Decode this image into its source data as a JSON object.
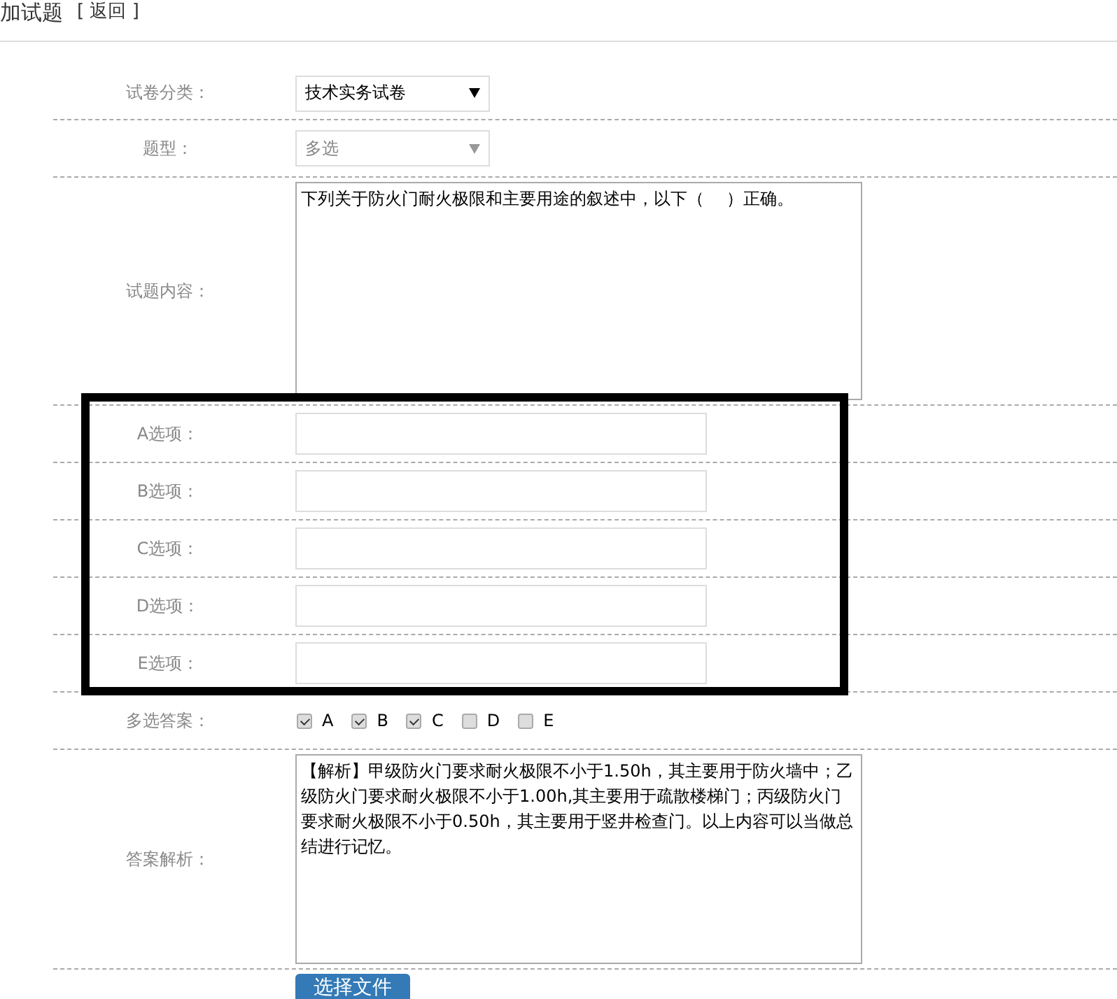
{
  "header": {
    "title": "加试题",
    "back_link": "[ 返回 ]"
  },
  "form": {
    "category": {
      "label": "试卷分类：",
      "value": "技术实务试卷",
      "disabled": false
    },
    "type": {
      "label": "题型：",
      "value": "多选",
      "disabled": true
    },
    "content": {
      "label": "试题内容：",
      "value": "下列关于防火门耐火极限和主要用途的叙述中，以下（　 ）正确。"
    },
    "options": [
      {
        "label": "A选项："
      },
      {
        "label": "B选项："
      },
      {
        "label": "C选项："
      },
      {
        "label": "D选项："
      },
      {
        "label": "E选项："
      }
    ],
    "answer": {
      "label": "多选答案：",
      "choices": [
        {
          "label": "A",
          "checked": true
        },
        {
          "label": "B",
          "checked": true
        },
        {
          "label": "C",
          "checked": true
        },
        {
          "label": "D",
          "checked": false
        },
        {
          "label": "E",
          "checked": false
        }
      ]
    },
    "analysis": {
      "label": "答案解析：",
      "value": "【解析】甲级防火门要求耐火极限不小于1.50h，其主要用于防火墙中；乙级防火门要求耐火极限不小于1.00h,其主要用于疏散楼梯门；丙级防火门要求耐火极限不小于0.50h，其主要用于竖井检查门。以上内容可以当做总结进行记忆。"
    },
    "file_button": "选择文件"
  }
}
